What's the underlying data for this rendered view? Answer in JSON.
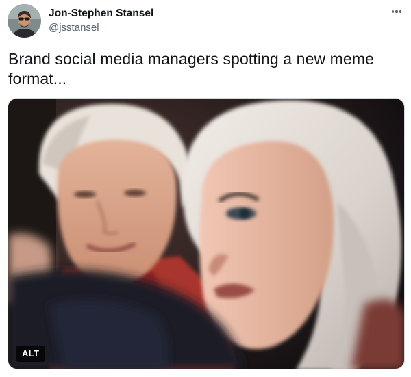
{
  "author": {
    "display_name": "Jon-Stephen Stansel",
    "handle": "@jsstansel"
  },
  "tweet": {
    "text": "Brand social media managers spotting a new meme format..."
  },
  "media": {
    "alt_label": "ALT"
  },
  "icons": {
    "more": "more-horizontal-icon"
  }
}
